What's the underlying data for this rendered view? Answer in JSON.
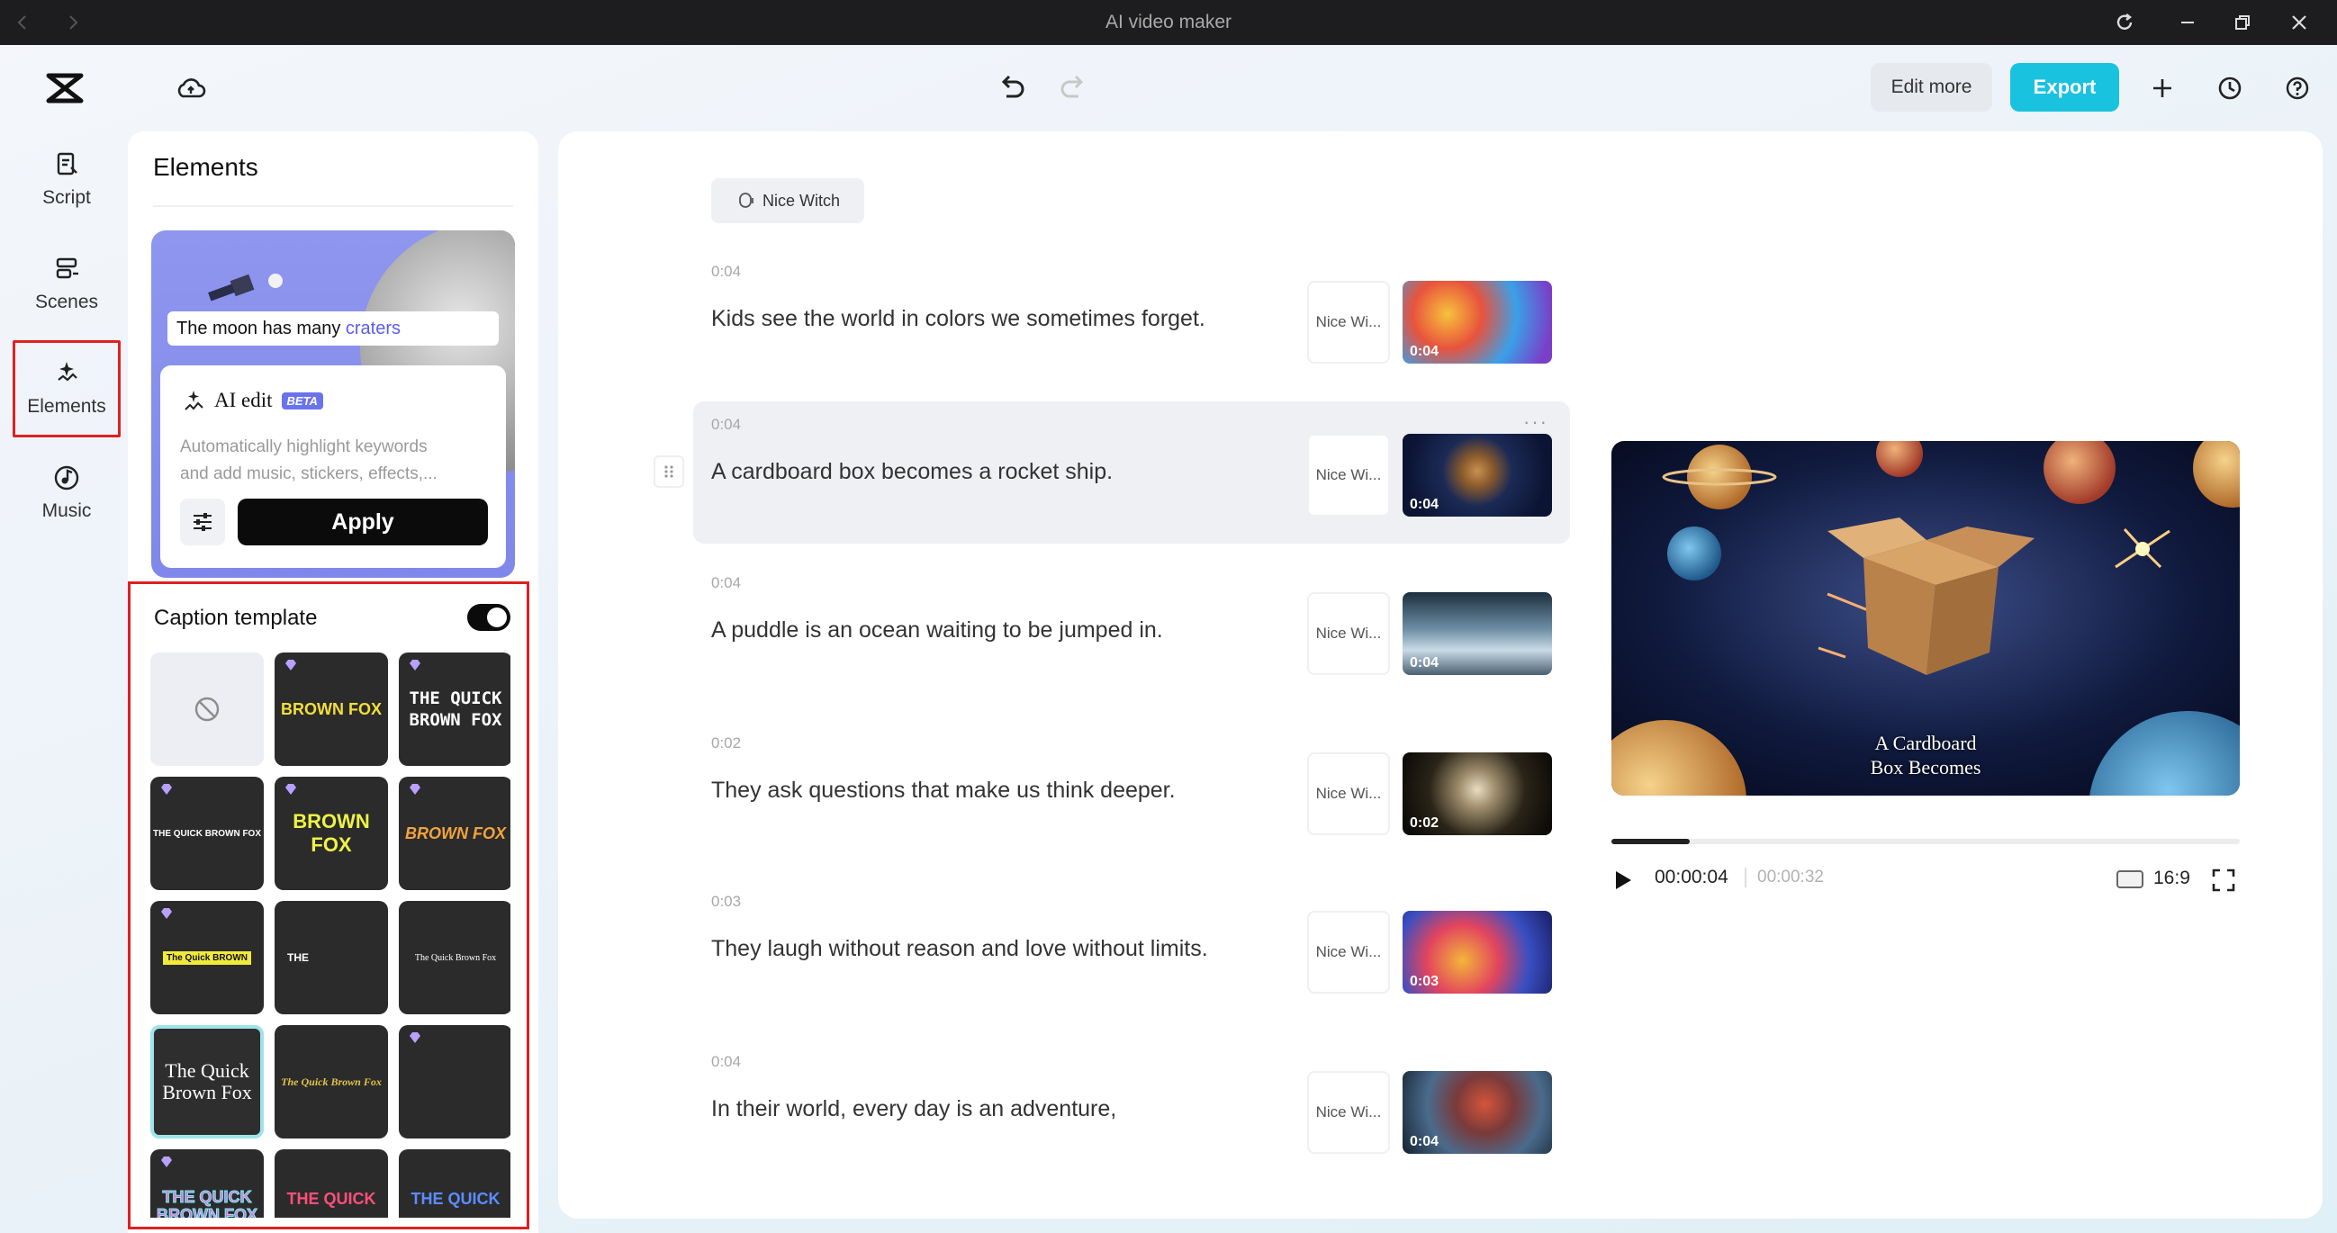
{
  "window": {
    "title": "AI video maker"
  },
  "toolbar": {
    "edit_more": "Edit more",
    "export": "Export"
  },
  "sidebar": {
    "items": [
      {
        "label": "Script",
        "icon": "script-icon"
      },
      {
        "label": "Scenes",
        "icon": "scenes-icon"
      },
      {
        "label": "Elements",
        "icon": "elements-icon",
        "active": true
      },
      {
        "label": "Music",
        "icon": "music-icon"
      }
    ]
  },
  "elements_panel": {
    "title": "Elements",
    "promo": {
      "caption_prefix": "The moon has many",
      "caption_highlight": "craters"
    },
    "ai_edit": {
      "title": "AI edit",
      "badge": "BETA",
      "description_line1": "Automatically highlight keywords",
      "description_line2": "and add music, stickers, effects,...",
      "apply": "Apply"
    },
    "caption_template": {
      "title": "Caption template",
      "enabled": true,
      "tiles": [
        {
          "text": "",
          "style": "none"
        },
        {
          "text": "BROWN FOX",
          "style": "yellow-white"
        },
        {
          "text": "THE QUICK BROWN FOX",
          "style": "white-pink"
        },
        {
          "text": "THE QUICK BROWN FOX",
          "style": "small-purple"
        },
        {
          "text": "BROWN FOX",
          "style": "yellow-bold"
        },
        {
          "text": "BROWN FOX",
          "style": "orange-italic"
        },
        {
          "text": "The Quick BROWN",
          "style": "yellow-bar"
        },
        {
          "text": "THE",
          "style": "white-small"
        },
        {
          "text": "The Quick Brown Fox",
          "style": "serif-small"
        },
        {
          "text": "The Quick Brown Fox",
          "style": "serif-selected"
        },
        {
          "text": "The Quick Brown Fox",
          "style": "script-yellow"
        },
        {
          "text": "",
          "style": "blank"
        },
        {
          "text": "THE QUICK BROWN FOX",
          "style": "cyan-pink"
        },
        {
          "text": "THE QUICK",
          "style": "pink-outline"
        },
        {
          "text": "THE QUICK",
          "style": "blue-outline"
        }
      ]
    }
  },
  "voice": {
    "name": "Nice Witch"
  },
  "segments": [
    {
      "duration": "0:04",
      "text": "Kids see the world in colors we sometimes forget.",
      "voice": "Nice Wi...",
      "thumb_label": "0:04",
      "thumb": "kids-colors"
    },
    {
      "duration": "0:04",
      "text": "A cardboard box becomes a rocket ship.",
      "voice": "Nice Wi...",
      "thumb_label": "0:04",
      "thumb": "box-space",
      "selected": true
    },
    {
      "duration": "0:04",
      "text": "A puddle is an ocean waiting to be jumped in.",
      "voice": "Nice Wi...",
      "thumb_label": "0:04",
      "thumb": "puddle"
    },
    {
      "duration": "0:02",
      "text": "They ask questions that make us think deeper.",
      "voice": "Nice Wi...",
      "thumb_label": "0:02",
      "thumb": "brain"
    },
    {
      "duration": "0:03",
      "text": "They laugh without reason and love without limits.",
      "voice": "Nice Wi...",
      "thumb_label": "0:03",
      "thumb": "kids-dance"
    },
    {
      "duration": "0:04",
      "text": "In their world, every day is an adventure,",
      "voice": "Nice Wi...",
      "thumb_label": "0:04",
      "thumb": "dragon"
    }
  ],
  "preview": {
    "caption_line1": "A Cardboard",
    "caption_line2": "Box Becomes",
    "current_time": "00:00:04",
    "total_time": "00:00:32",
    "aspect_ratio": "16:9",
    "progress_fraction": 0.125
  }
}
